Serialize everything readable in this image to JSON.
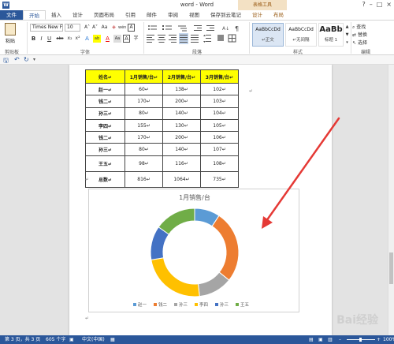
{
  "window": {
    "title": "word - Word",
    "context_tools": "表格工具",
    "win_buttons": [
      "?",
      "–",
      "□",
      "×"
    ]
  },
  "tabs": [
    "文件",
    "开始",
    "插入",
    "设计",
    "页面布局",
    "引用",
    "邮件",
    "审阅",
    "视图",
    "保存到云笔记",
    "设计",
    "布局"
  ],
  "ribbon": {
    "paste_label": "粘贴",
    "font_name": "Times New F",
    "font_size": "10",
    "font_buttons": [
      "A˄",
      "A˅",
      "Aa",
      "◈",
      "wén",
      "A"
    ],
    "format_buttons": [
      "B",
      "I",
      "U",
      "abc",
      "x₂",
      "x²",
      "A",
      "ab",
      "A",
      "Aa",
      "A",
      "字"
    ],
    "styles": [
      {
        "sample": "AaBbCcDd",
        "name": "↵正文"
      },
      {
        "sample": "AaBbCcDd",
        "name": "↵无间隔"
      },
      {
        "sample": "AaBb",
        "name": "标题 1"
      }
    ],
    "edit_items": [
      "查找",
      "替换",
      "选择"
    ],
    "group_labels": [
      "剪贴板",
      "字体",
      "段落",
      "样式",
      "编辑"
    ]
  },
  "table": {
    "headers": [
      "姓名↵",
      "1月销售/台↵",
      "2月销售/台↵",
      "3月销售/台↵"
    ],
    "rows": [
      [
        "赵一↵",
        "60↵",
        "138↵",
        "102↵"
      ],
      [
        "钱二↵",
        "170↵",
        "200↵",
        "103↵"
      ],
      [
        "孙三↵",
        "80↵",
        "140↵",
        "104↵"
      ],
      [
        "李四↵",
        "155↵",
        "130↵",
        "105↵"
      ],
      [
        "钱二↵",
        "170↵",
        "200↵",
        "106↵"
      ],
      [
        "孙三↵",
        "80↵",
        "140↵",
        "107↵"
      ],
      [
        "王五↵",
        "98↵",
        "116↵",
        "108↵"
      ],
      [
        "总数↵",
        "816↵",
        "1064↵",
        "735↵"
      ]
    ]
  },
  "chart_data": {
    "type": "pie",
    "title": "1月销售/台",
    "categories": [
      "赵一",
      "钱二",
      "孙三",
      "李四",
      "孙三",
      "王五"
    ],
    "values": [
      60,
      170,
      80,
      155,
      80,
      98
    ],
    "colors": [
      "#5b9bd5",
      "#ed7d31",
      "#a5a5a5",
      "#ffc000",
      "#4472c4",
      "#70ad47"
    ],
    "legend": "bottom",
    "style": "doughnut"
  },
  "status": {
    "page": "第 3 页，共 3 页",
    "words": "605 个字",
    "lang": "中文(中国)",
    "zoom": "100%"
  },
  "watermark": "Bai经验"
}
